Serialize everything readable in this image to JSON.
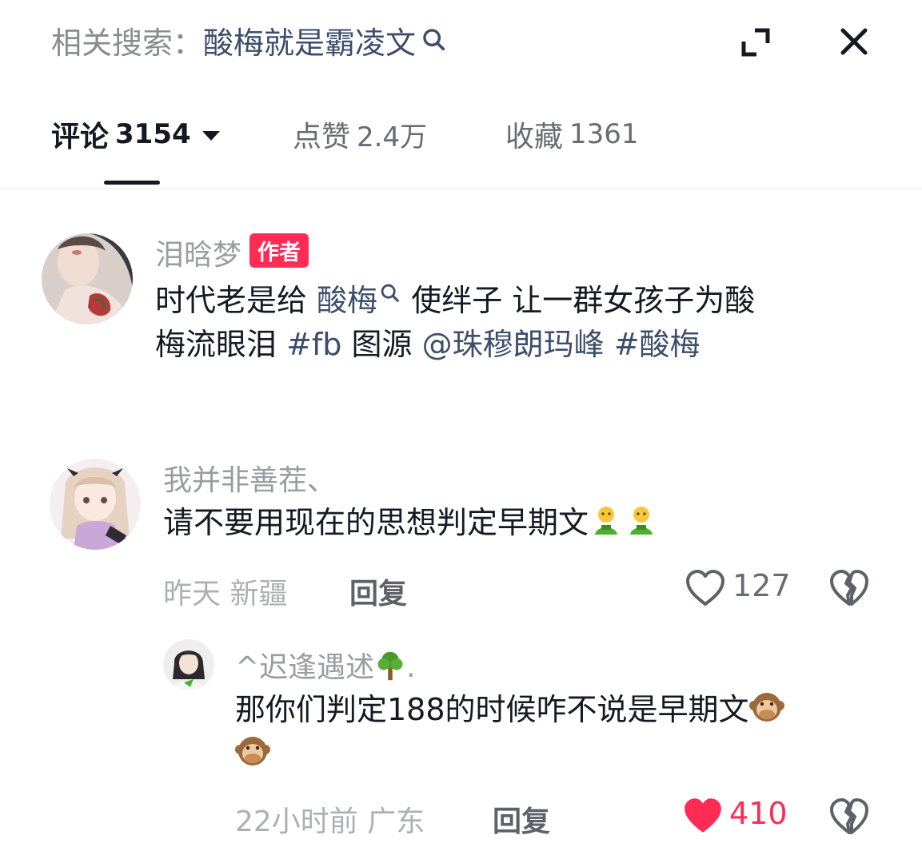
{
  "header": {
    "related_label": "相关搜索：",
    "related_query": "酸梅就是霸凌文"
  },
  "tabs": [
    {
      "label": "评论",
      "count": "3154"
    },
    {
      "label": "点赞",
      "count": "2.4万"
    },
    {
      "label": "收藏",
      "count": "1361"
    }
  ],
  "post": {
    "author": "泪晗梦",
    "badge": "作者",
    "line1_a": "时代老是给 ",
    "line1_link": "酸梅",
    "line1_b": " 使绊子 让一群女孩子为酸",
    "line2_a": "梅流眼泪 ",
    "tag1": "#fb",
    "line2_b": " 图源 ",
    "mention": "@珠穆朗玛峰",
    "tag2": " #酸梅"
  },
  "comment": {
    "author": "我并非善茬、",
    "text": "请不要用现在的思想判定早期文",
    "emoji": "farmer-emoji",
    "time": "昨天",
    "location": "新疆",
    "reply_label": "回复",
    "likes": "127"
  },
  "reply": {
    "author": "^迟逢遇述",
    "author_suffix": ".",
    "author_emoji": "tree-emoji",
    "text": "那你们判定188的时候咋不说是早期文",
    "emoji": "monkey-emoji",
    "time": "22小时前",
    "location": "广东",
    "reply_label": "回复",
    "likes": "410"
  },
  "colors": {
    "accent": "#fe2c55",
    "link": "#3d4d6b",
    "text": "#161823",
    "muted": "#9b9ca2"
  }
}
